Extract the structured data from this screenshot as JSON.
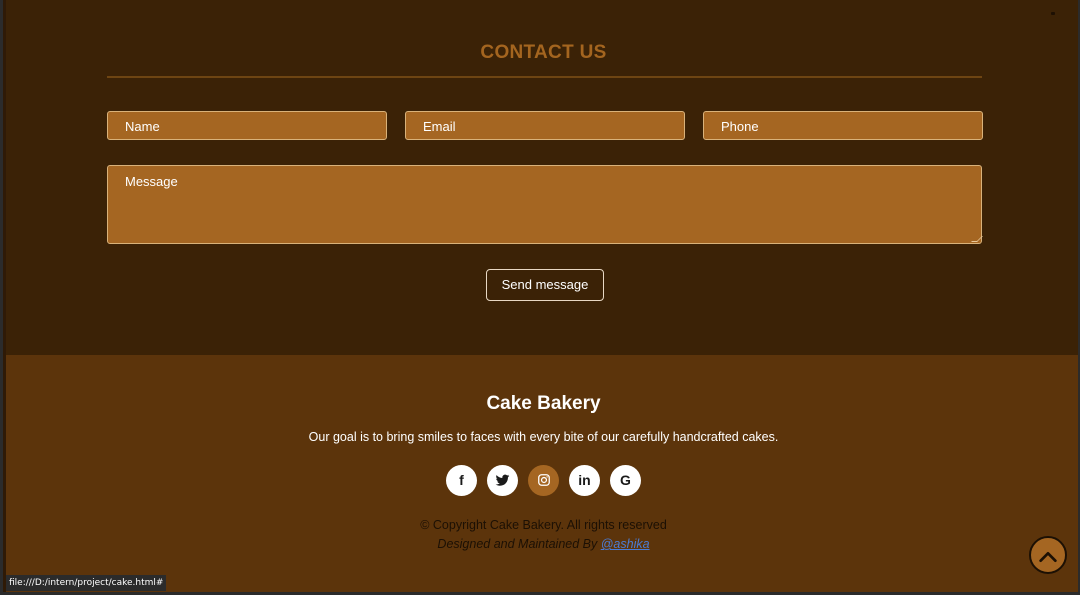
{
  "contact": {
    "title": "CONTACT US",
    "name_placeholder": "Name",
    "email_placeholder": "Email",
    "phone_placeholder": "Phone",
    "message_placeholder": "Message",
    "send_label": "Send message"
  },
  "footer": {
    "brand": "Cake Bakery",
    "tagline": "Our goal is to bring smiles to faces with every bite of our carefully handcrafted cakes.",
    "socials": [
      {
        "icon": "facebook-icon",
        "glyph": "f"
      },
      {
        "icon": "twitter-icon",
        "glyph": ""
      },
      {
        "icon": "instagram-icon",
        "glyph": ""
      },
      {
        "icon": "linkedin-icon",
        "glyph": "in"
      },
      {
        "icon": "google-icon",
        "glyph": "G"
      }
    ],
    "copyright": "© Copyright Cake Bakery. All rights reserved",
    "credit_prefix": "Designed and Maintained By ",
    "credit_link": "@ashika"
  },
  "status_bar": {
    "url": "file:///D:/intern/project/cake.html#"
  },
  "colors": {
    "contact_bg": "#3b2206",
    "footer_bg": "#5c340b",
    "accent": "#a56622",
    "title": "#a4651f"
  },
  "icons": {
    "scroll_top": "chevron-up-icon"
  }
}
